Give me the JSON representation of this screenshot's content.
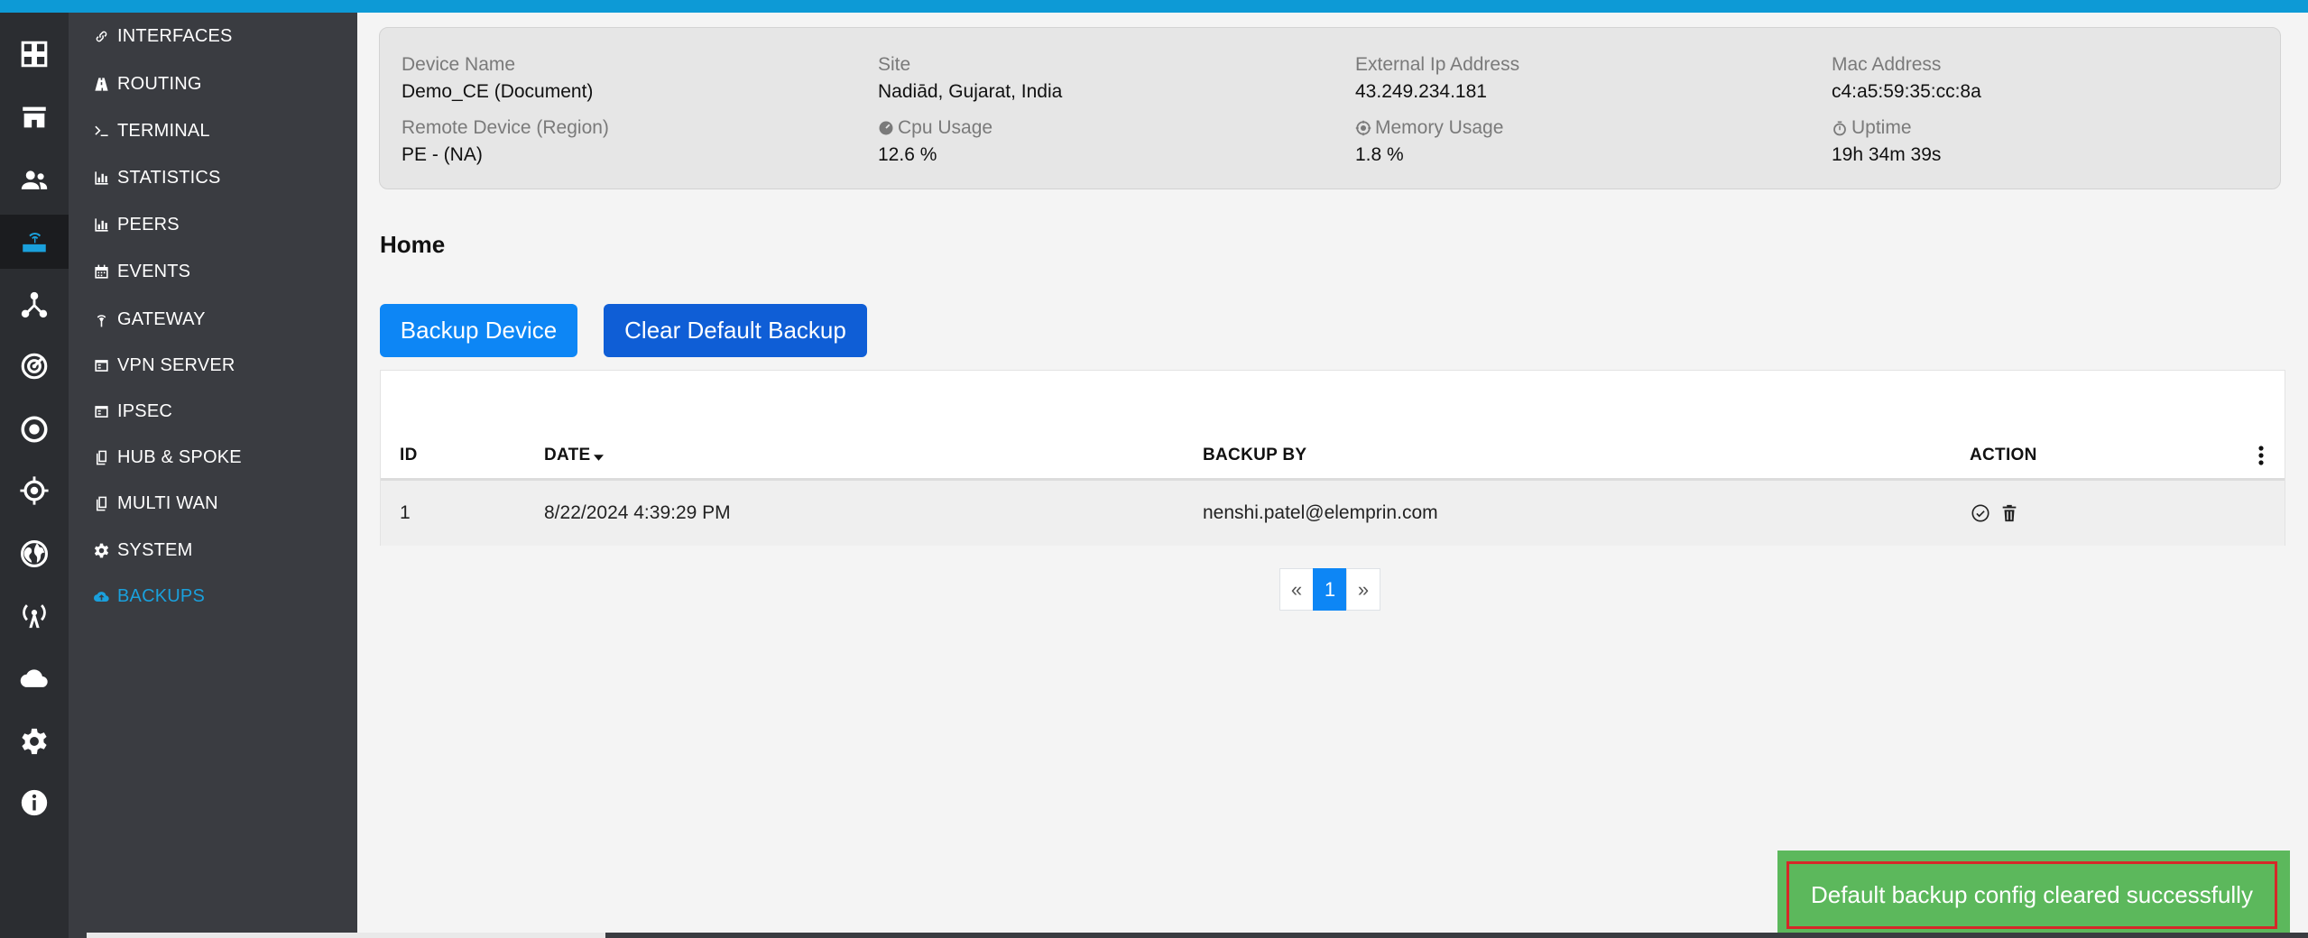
{
  "colors": {
    "accent": "#0d9ad6",
    "sidebar_bg": "#3a3c41",
    "rail_bg": "#2b2d31",
    "active": "#1aa0dc",
    "primary_button": "#0d86f5",
    "secondary_button": "#0f5ed6",
    "toast_bg": "#5cb85c",
    "toast_border": "#d62828"
  },
  "rail": {
    "icons": [
      "dashboard-grid-icon",
      "store-icon",
      "users-icon",
      "router-icon",
      "network-topology-icon",
      "radar-icon",
      "target-circle-icon",
      "crosshair-icon",
      "globe-icon",
      "wireless-tower-icon",
      "cloud-icon",
      "gear-icon",
      "info-icon"
    ],
    "active_icon": "router-icon"
  },
  "sidebar": {
    "items": [
      {
        "label": "INTERFACES",
        "icon": "link-icon"
      },
      {
        "label": "ROUTING",
        "icon": "road-icon"
      },
      {
        "label": "TERMINAL",
        "icon": "terminal-icon"
      },
      {
        "label": "STATISTICS",
        "icon": "bar-chart-icon"
      },
      {
        "label": "PEERS",
        "icon": "bar-chart-icon"
      },
      {
        "label": "EVENTS",
        "icon": "calendar-icon"
      },
      {
        "label": "GATEWAY",
        "icon": "broadcast-icon"
      },
      {
        "label": "VPN SERVER",
        "icon": "server-icon"
      },
      {
        "label": "IPSEC",
        "icon": "server-icon"
      },
      {
        "label": "HUB & SPOKE",
        "icon": "documents-icon"
      },
      {
        "label": "MULTI WAN",
        "icon": "documents-icon"
      },
      {
        "label": "SYSTEM",
        "icon": "gear-icon"
      },
      {
        "label": "BACKUPS",
        "icon": "cloud-upload-icon",
        "active": true
      }
    ]
  },
  "device_info": {
    "device_name": {
      "label": "Device Name",
      "value": "Demo_CE (Document)"
    },
    "site": {
      "label": "Site",
      "value": "Nadiād, Gujarat, India"
    },
    "external_ip": {
      "label": "External Ip Address",
      "value": "43.249.234.181"
    },
    "mac": {
      "label": "Mac Address",
      "value": "c4:a5:59:35:cc:8a"
    },
    "remote_device": {
      "label": "Remote Device (Region)",
      "value": "PE - (NA)"
    },
    "cpu": {
      "label": "Cpu Usage",
      "value": "12.6 %"
    },
    "memory": {
      "label": "Memory Usage",
      "value": "1.8 %"
    },
    "uptime": {
      "label": "Uptime",
      "value": "19h 34m 39s"
    }
  },
  "page": {
    "title": "Home",
    "backup_button": "Backup Device",
    "clear_button": "Clear Default Backup"
  },
  "table": {
    "headers": {
      "id": "ID",
      "date": "DATE",
      "backup_by": "BACKUP BY",
      "action": "ACTION"
    },
    "rows": [
      {
        "id": "1",
        "date": "8/22/2024 4:39:29 PM",
        "backup_by": "nenshi.patel@elemprin.com"
      }
    ]
  },
  "pagination": {
    "prev": "«",
    "current": "1",
    "next": "»"
  },
  "toast": {
    "message": "Default backup config cleared successfully"
  }
}
